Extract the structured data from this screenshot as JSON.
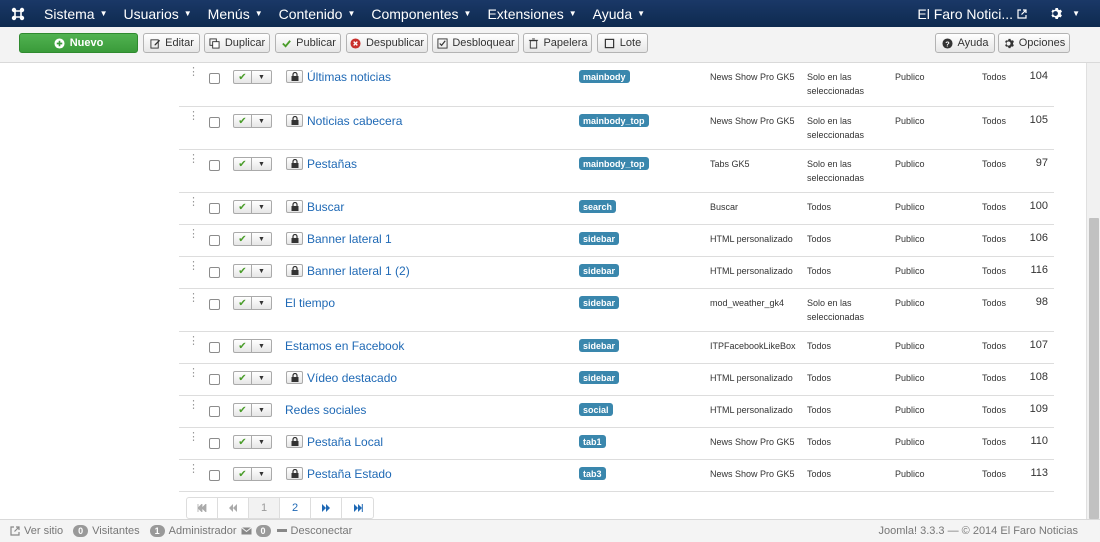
{
  "navbar": {
    "menu": [
      "Sistema",
      "Usuarios",
      "Menús",
      "Contenido",
      "Componentes",
      "Extensiones",
      "Ayuda"
    ],
    "site_name": "El Faro Notici..."
  },
  "toolbar": {
    "new": "Nuevo",
    "edit": "Editar",
    "duplicate": "Duplicar",
    "publish": "Publicar",
    "unpublish": "Despublicar",
    "unlock": "Desbloquear",
    "trash": "Papelera",
    "batch": "Lote",
    "help": "Ayuda",
    "options": "Opciones"
  },
  "rows": [
    {
      "title": "Últimas noticias",
      "locked": true,
      "position": "mainbody",
      "type": "News Show Pro GK5",
      "pages": "Solo en las seleccionadas",
      "access": "Publico",
      "language": "Todos",
      "id": "104"
    },
    {
      "title": "Noticias cabecera",
      "locked": true,
      "position": "mainbody_top",
      "type": "News Show Pro GK5",
      "pages": "Solo en las seleccionadas",
      "access": "Publico",
      "language": "Todos",
      "id": "105"
    },
    {
      "title": "Pestañas",
      "locked": true,
      "position": "mainbody_top",
      "type": "Tabs GK5",
      "pages": "Solo en las seleccionadas",
      "access": "Publico",
      "language": "Todos",
      "id": "97"
    },
    {
      "title": "Buscar",
      "locked": true,
      "position": "search",
      "type": "Buscar",
      "pages": "Todos",
      "access": "Publico",
      "language": "Todos",
      "id": "100"
    },
    {
      "title": "Banner lateral 1",
      "locked": true,
      "position": "sidebar",
      "type": "HTML personalizado",
      "pages": "Todos",
      "access": "Publico",
      "language": "Todos",
      "id": "106"
    },
    {
      "title": "Banner lateral 1 (2)",
      "locked": true,
      "position": "sidebar",
      "type": "HTML personalizado",
      "pages": "Todos",
      "access": "Publico",
      "language": "Todos",
      "id": "116"
    },
    {
      "title": "El tiempo",
      "locked": false,
      "position": "sidebar",
      "type": "mod_weather_gk4",
      "pages": "Solo en las seleccionadas",
      "access": "Publico",
      "language": "Todos",
      "id": "98"
    },
    {
      "title": "Estamos en Facebook",
      "locked": false,
      "position": "sidebar",
      "type": "ITPFacebookLikeBox",
      "pages": "Todos",
      "access": "Publico",
      "language": "Todos",
      "id": "107"
    },
    {
      "title": "Vídeo destacado",
      "locked": true,
      "position": "sidebar",
      "type": "HTML personalizado",
      "pages": "Todos",
      "access": "Publico",
      "language": "Todos",
      "id": "108"
    },
    {
      "title": "Redes sociales",
      "locked": false,
      "position": "social",
      "type": "HTML personalizado",
      "pages": "Todos",
      "access": "Publico",
      "language": "Todos",
      "id": "109"
    },
    {
      "title": "Pestaña Local",
      "locked": true,
      "position": "tab1",
      "type": "News Show Pro GK5",
      "pages": "Todos",
      "access": "Publico",
      "language": "Todos",
      "id": "110"
    },
    {
      "title": "Pestaña Estado",
      "locked": true,
      "position": "tab3",
      "type": "News Show Pro GK5",
      "pages": "Todos",
      "access": "Publico",
      "language": "Todos",
      "id": "113"
    }
  ],
  "pagination": {
    "pages": [
      "1",
      "2"
    ],
    "current": "1"
  },
  "statusbar": {
    "view_site": "Ver sitio",
    "visitors_count": "0",
    "visitors": "Visitantes",
    "admin_count": "1",
    "admin": "Administrador",
    "messages_count": "0",
    "logout": "Desconectar",
    "version": "Joomla! 3.3.3  —  © 2014 El Faro Noticias"
  }
}
